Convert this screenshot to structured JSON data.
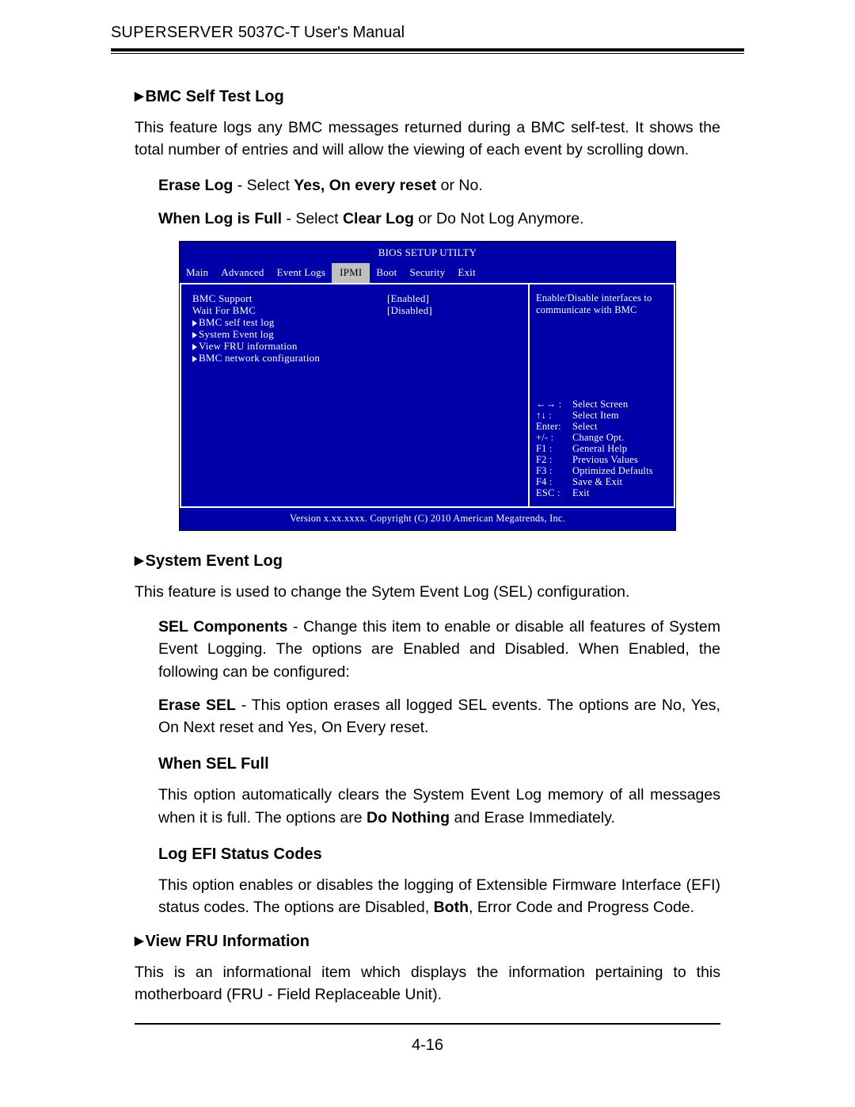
{
  "header": {
    "line1_prefix": "S",
    "line1_sc": "UPER",
    "line1_prefix2": "S",
    "line1_sc2": "ERVER",
    "line1_rest": " 5037C-T User's Manual"
  },
  "sections": {
    "bmc_selftest": {
      "title": "BMC Self Test Log",
      "para": "This feature logs any BMC messages returned during a BMC self-test.  It shows the total number of entries and will allow the viewing of each event by scrolling down.",
      "erase_log": {
        "label": "Erase Log",
        "mid": " - Select ",
        "bold": "Yes, On every reset",
        "tail": " or No."
      },
      "when_full": {
        "label": "When Log is Full",
        "mid": " - Select ",
        "bold": "Clear Log",
        "tail": " or Do Not Log Anymore."
      }
    },
    "sel": {
      "title": "System Event Log",
      "para": "This feature is used to change the Sytem Event Log (SEL) configuration.",
      "components": {
        "label": "SEL Components",
        "tail": " - Change this item to enable or disable all features of System Event Logging.  The options are Enabled and Disabled.  When Enabled, the following can be configured:"
      },
      "erase_sel": {
        "label": "Erase SEL",
        "tail": " - This option erases all logged SEL events.  The options are No, Yes, On Next reset and Yes, On Every reset."
      },
      "when_full": {
        "title": "When SEL Full",
        "para_a": "This option automatically clears the System Event Log memory of all messages when it is full.  The options are ",
        "bold": "Do Nothing",
        "para_b": " and Erase Immediately."
      },
      "efi": {
        "title": "Log EFI Status Codes",
        "para_a": "This option enables or disables the logging of Extensible Firmware Interface (EFI) status codes. The options are Disabled, ",
        "bold": "Both",
        "para_b": ", Error Code and Progress Code."
      }
    },
    "fru": {
      "title": "View FRU Information",
      "para": "This is an informational item which displays the information pertaining to this motherboard  (FRU - Field Replaceable Unit)."
    }
  },
  "bios": {
    "title": "BIOS SETUP UTILTY",
    "tabs": [
      "Main",
      "Advanced",
      "Event Logs",
      "IPMI",
      "Boot",
      "Security",
      "Exit"
    ],
    "selected_tab_index": 3,
    "left_items": [
      {
        "label": "BMC Support",
        "value": "[Enabled]",
        "submenu": false
      },
      {
        "label": "Wait For BMC",
        "value": "[Disabled]",
        "submenu": false
      },
      {
        "label": "BMC self test log",
        "value": "",
        "submenu": true
      },
      {
        "label": "System Event log",
        "value": "",
        "submenu": true
      },
      {
        "label": "View FRU information",
        "value": "",
        "submenu": true
      },
      {
        "label": "BMC network configuration",
        "value": "",
        "submenu": true
      }
    ],
    "help": "Enable/Disable interfaces to communicate with BMC",
    "keys": [
      {
        "k": "←→ :",
        "v": "Select Screen"
      },
      {
        "k": "↑↓  :",
        "v": "Select Item"
      },
      {
        "k": "Enter:",
        "v": "Select"
      },
      {
        "k": "+/-  :",
        "v": "Change Opt."
      },
      {
        "k": "F1 :",
        "v": "General Help"
      },
      {
        "k": "F2 :",
        "v": "Previous Values"
      },
      {
        "k": "F3 :",
        "v": "Optimized Defaults"
      },
      {
        "k": "F4 :",
        "v": "Save & Exit"
      },
      {
        "k": "ESC :",
        "v": "Exit"
      }
    ],
    "footer": "Version x.xx.xxxx. Copyright (C) 2010 American Megatrends, Inc."
  },
  "page_number": "4-16"
}
